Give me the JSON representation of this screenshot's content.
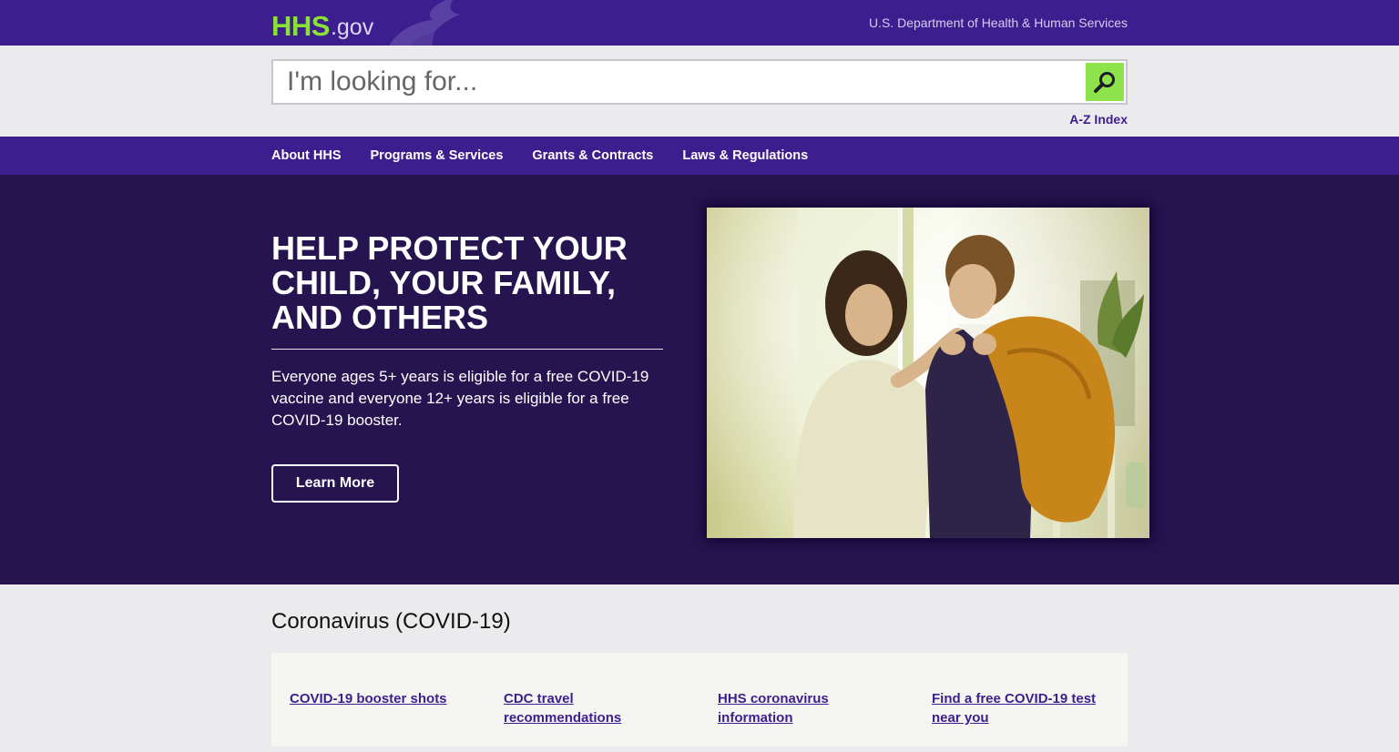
{
  "header": {
    "logo_main": "HHS",
    "logo_suffix": ".gov",
    "department": "U.S. Department of Health & Human Services",
    "brand_color": "#3d1e8f",
    "logo_color": "#8ae234"
  },
  "search": {
    "placeholder": "I'm looking for...",
    "value": "",
    "button_icon": "search-icon",
    "az_link": "A-Z Index"
  },
  "nav": {
    "items": [
      {
        "label": "About HHS"
      },
      {
        "label": "Programs & Services"
      },
      {
        "label": "Grants & Contracts"
      },
      {
        "label": "Laws & Regulations"
      }
    ]
  },
  "hero": {
    "title": "HELP PROTECT YOUR CHILD, YOUR FAMILY, AND OTHERS",
    "text": "Everyone ages 5+ years is eligible for a free COVID-19 vaccine and everyone 12+ years is eligible for a free COVID-19 booster.",
    "button_label": "Learn More",
    "image_alt": "Mother adjusting her son's backpack"
  },
  "covid": {
    "title": "Coronavirus (COVID-19)",
    "links": [
      {
        "label": "COVID-19 booster shots"
      },
      {
        "label": "CDC travel recommendations"
      },
      {
        "label": "HHS coronavirus information"
      },
      {
        "label": "Find a free COVID-19 test near you"
      }
    ]
  }
}
